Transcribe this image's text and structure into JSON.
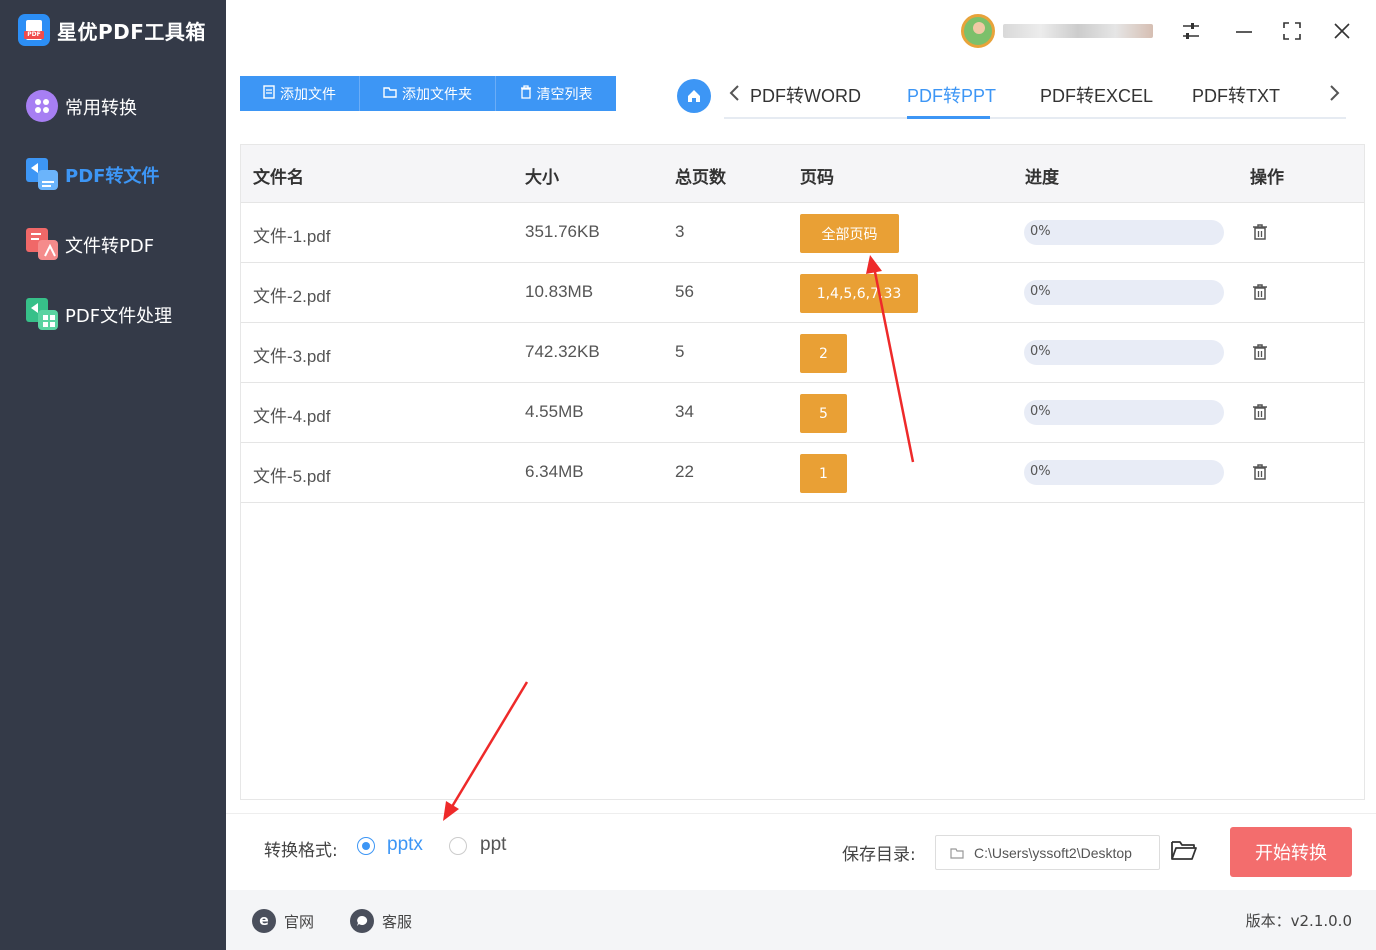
{
  "app": {
    "title": "星优PDF工具箱",
    "logo_tag": "PDF"
  },
  "sidebar": {
    "items": [
      {
        "label": "常用转换",
        "icon": "grid-icon"
      },
      {
        "label": "PDF转文件",
        "icon": "pdf-to-file-icon",
        "active": true
      },
      {
        "label": "文件转PDF",
        "icon": "file-to-pdf-icon"
      },
      {
        "label": "PDF文件处理",
        "icon": "pdf-process-icon"
      }
    ]
  },
  "toolbar": {
    "add_file": "添加文件",
    "add_folder": "添加文件夹",
    "clear_list": "清空列表"
  },
  "tabs": [
    {
      "label": "PDF转WORD"
    },
    {
      "label": "PDF转PPT",
      "active": true
    },
    {
      "label": "PDF转EXCEL"
    },
    {
      "label": "PDF转TXT"
    }
  ],
  "table": {
    "headers": {
      "name": "文件名",
      "size": "大小",
      "pages": "总页数",
      "range": "页码",
      "progress": "进度",
      "action": "操作"
    },
    "rows": [
      {
        "name": "文件-1.pdf",
        "size": "351.76KB",
        "pages": "3",
        "range": "全部页码",
        "progress": "0%",
        "progress_value": 0
      },
      {
        "name": "文件-2.pdf",
        "size": "10.83MB",
        "pages": "56",
        "range": "1,4,5,6,7,33",
        "progress": "0%",
        "progress_value": 0
      },
      {
        "name": "文件-3.pdf",
        "size": "742.32KB",
        "pages": "5",
        "range": "2",
        "progress": "0%",
        "progress_value": 0
      },
      {
        "name": "文件-4.pdf",
        "size": "4.55MB",
        "pages": "34",
        "range": "5",
        "progress": "0%",
        "progress_value": 0
      },
      {
        "name": "文件-5.pdf",
        "size": "6.34MB",
        "pages": "22",
        "range": "1",
        "progress": "0%",
        "progress_value": 0
      }
    ]
  },
  "bottom": {
    "format_label": "转换格式:",
    "formats": [
      {
        "label": "pptx",
        "selected": true
      },
      {
        "label": "ppt",
        "selected": false
      }
    ],
    "save_label": "保存目录:",
    "save_path": "C:\\Users\\yssoft2\\Desktop",
    "start_button": "开始转换"
  },
  "footer": {
    "website": "官网",
    "support": "客服",
    "version": "版本：v2.1.0.0"
  },
  "colors": {
    "accent": "#3d96f5",
    "sidebar": "#343a48",
    "page_button": "#e9a035",
    "start_button": "#f36d6d"
  }
}
